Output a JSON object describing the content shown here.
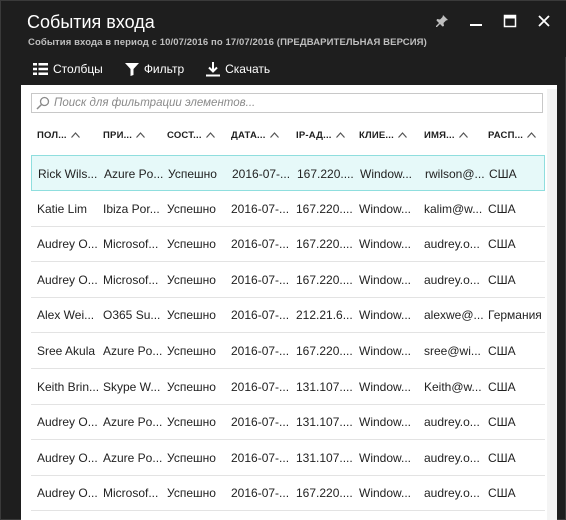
{
  "header": {
    "title": "События входа",
    "subtitle": "События входа в период с 10/07/2016 по 17/07/2016 (ПРЕДВАРИТЕЛЬНАЯ ВЕРСИЯ)"
  },
  "toolbar": {
    "columns_label": "Столбцы",
    "filter_label": "Фильтр",
    "download_label": "Скачать"
  },
  "search": {
    "placeholder": "Поиск для фильтрации элементов..."
  },
  "table": {
    "headers": [
      "ПОЛ...",
      "ПРИ...",
      "СОСТ...",
      "ДАТА...",
      "IP-АД...",
      "КЛИЕ...",
      "ИМЯ...",
      "РАСП..."
    ],
    "rows": [
      [
        "Rick Wils...",
        "Azure Po...",
        "Успешно",
        "2016-07-...",
        "167.220....",
        "Window...",
        "rwilson@...",
        "США"
      ],
      [
        "Katie Lim",
        "Ibiza Por...",
        "Успешно",
        "2016-07-...",
        "167.220....",
        "Window...",
        "kalim@w...",
        "США"
      ],
      [
        "Audrey O...",
        "Microsof...",
        "Успешно",
        "2016-07-...",
        "167.220....",
        "Window...",
        "audrey.o...",
        "США"
      ],
      [
        "Audrey O...",
        "Microsof...",
        "Успешно",
        "2016-07-...",
        "167.220....",
        "Window...",
        "audrey.o...",
        "США"
      ],
      [
        "Alex Wei...",
        "O365 Su...",
        "Успешно",
        "2016-07-...",
        "212.21.6...",
        "Window...",
        "alexwe@...",
        "Германия"
      ],
      [
        "Sree Akula",
        "Azure Po...",
        "Успешно",
        "2016-07-...",
        "167.220....",
        "Window...",
        "sree@wi...",
        "США"
      ],
      [
        "Keith Brin...",
        "Skype W...",
        "Успешно",
        "2016-07-...",
        "131.107....",
        "Window...",
        "Keith@w...",
        "США"
      ],
      [
        "Audrey O...",
        "Azure Po...",
        "Успешно",
        "2016-07-...",
        "131.107....",
        "Window...",
        "audrey.o...",
        "США"
      ],
      [
        "Audrey O...",
        "Azure Po...",
        "Успешно",
        "2016-07-...",
        "131.107....",
        "Window...",
        "audrey.o...",
        "США"
      ],
      [
        "Audrey O...",
        "Microsof...",
        "Успешно",
        "2016-07-...",
        "167.220....",
        "Window...",
        "audrey.o...",
        "США"
      ]
    ]
  },
  "colors": {
    "header_bg": "#1e1e1e",
    "selected_row_bg": "#e6f9f9",
    "selected_row_border": "#8fdede"
  }
}
